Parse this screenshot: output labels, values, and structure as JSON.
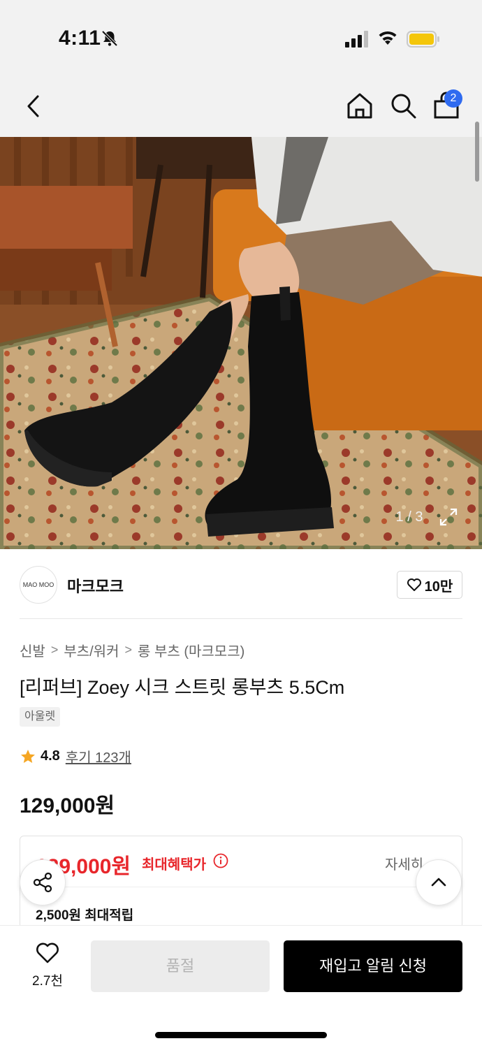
{
  "status_bar": {
    "time": "4:11"
  },
  "nav": {
    "cart_count": "2"
  },
  "gallery": {
    "counter": "1 / 3"
  },
  "brand": {
    "logo_text": "MAO MOO",
    "name": "마크모크",
    "likes": "10만"
  },
  "breadcrumb": [
    "신발",
    "부츠/워커",
    "롱 부츠 (마크모크)"
  ],
  "product": {
    "title": "[리퍼브] Zoey 시크 스트릿 롱부츠 5.5Cm",
    "tag": "아울렛",
    "rating": "4.8",
    "reviews": "후기 123개",
    "price": "129,000원"
  },
  "benefit": {
    "max_price": "129,000원",
    "label": "최대혜택가",
    "detail_link": "자세히",
    "points": "2,500원 최대적립"
  },
  "bottom_bar": {
    "wish_count": "2.7천",
    "soldout_label": "품절",
    "restock_label": "재입고 알림 신청"
  },
  "colors": {
    "accent_red": "#e8262b",
    "badge_blue": "#2f6bf0",
    "star": "#f5a623"
  }
}
